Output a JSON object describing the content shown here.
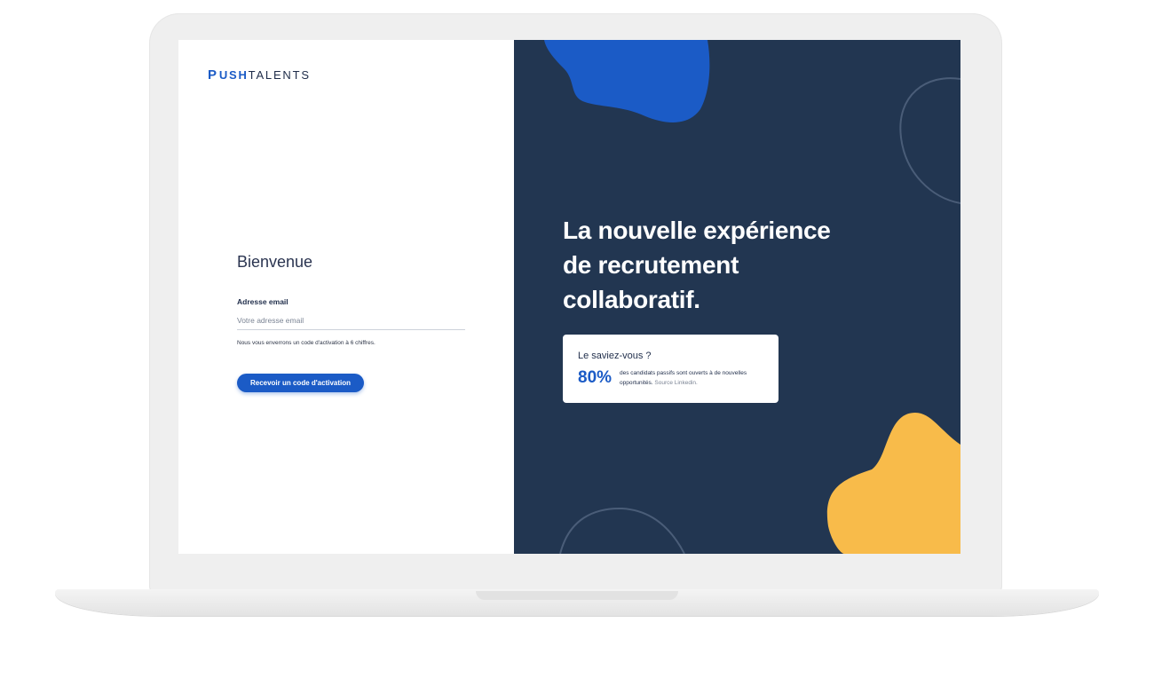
{
  "brand": {
    "logo_mark": "P",
    "logo_push": "USH",
    "logo_talents": "TALENTS"
  },
  "form": {
    "welcome": "Bienvenue",
    "email_label": "Adresse email",
    "email_value": "",
    "email_placeholder": "Votre adresse email",
    "hint": "Nous vous enverrons un code d'activation à 6 chiffres.",
    "submit_label": "Recevoir un code d'activation"
  },
  "hero": {
    "headline_line1": "La nouvelle expérience",
    "headline_line2": "de recrutement",
    "headline_line3": "collaboratif."
  },
  "stat_card": {
    "title": "Le saviez-vous ?",
    "value": "80%",
    "text": "des candidats passifs sont ouverts à de nouvelles opportunités.",
    "source": "Source Linkedin."
  },
  "colors": {
    "brand_blue": "#1b5bc6",
    "navy": "#223651",
    "accent_yellow": "#f8bb4a"
  }
}
